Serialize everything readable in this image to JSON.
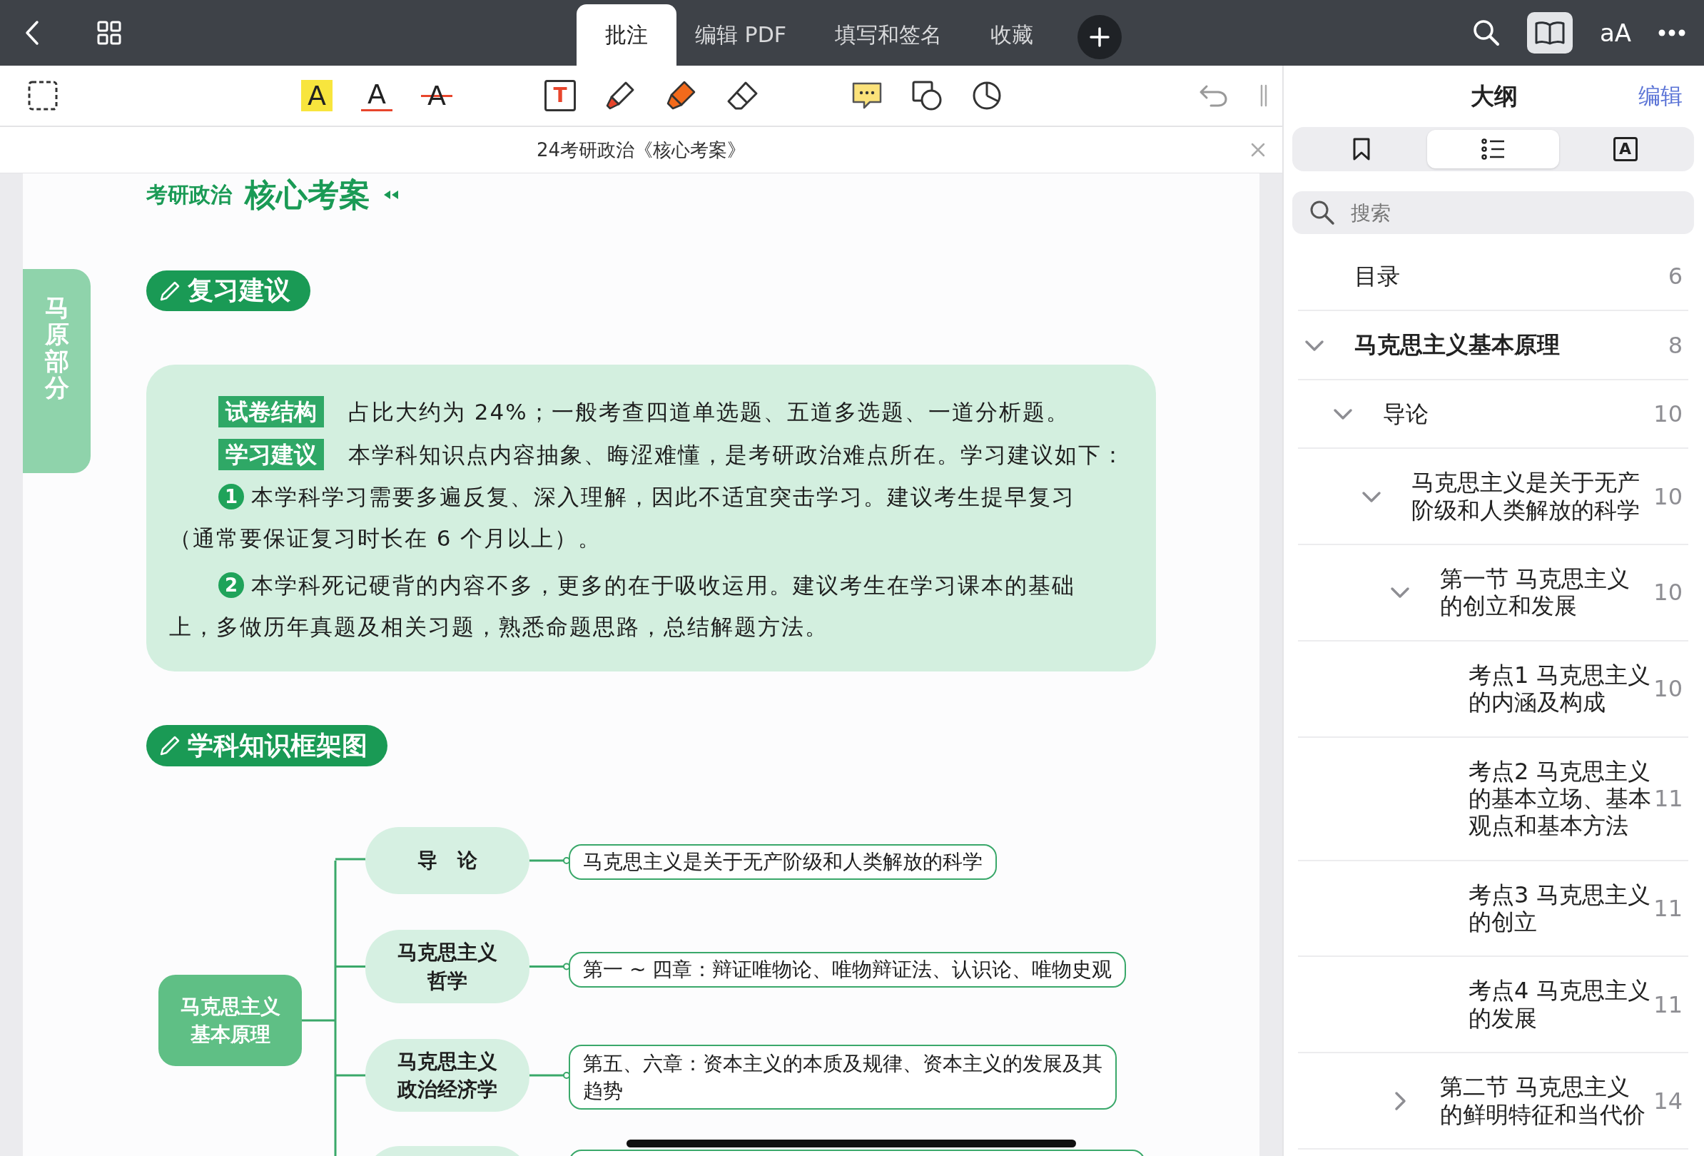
{
  "top_bar": {
    "tabs": [
      {
        "label": "批注",
        "selected": true
      },
      {
        "label": "编辑 PDF",
        "selected": false
      },
      {
        "label": "填写和签名",
        "selected": false
      },
      {
        "label": "收藏",
        "selected": false
      }
    ],
    "reader_view": {
      "selected": true
    },
    "font_button": "aA"
  },
  "toolbar": {
    "tools": [
      {
        "kind": "select"
      },
      {
        "kind": "highlight",
        "glyph": "A"
      },
      {
        "kind": "underline",
        "glyph": "A"
      },
      {
        "kind": "strikethrough",
        "glyph": "A"
      },
      {
        "kind": "textbox",
        "glyph": "T"
      },
      {
        "kind": "pen"
      },
      {
        "kind": "marker"
      },
      {
        "kind": "eraser"
      },
      {
        "kind": "comment"
      },
      {
        "kind": "shapes"
      },
      {
        "kind": "lasso"
      }
    ]
  },
  "document": {
    "title": "24考研政治《核心考案》",
    "header": {
      "small": "考研政治",
      "large": "核心考案"
    },
    "side_tab": "马原部分",
    "review": {
      "heading": "复习建议",
      "items": [
        {
          "kind": "labeled",
          "label": "试卷结构",
          "lines": [
            "占比大约为 24%；一般考查四道单选题、五道多选题、一道分析题。"
          ]
        },
        {
          "kind": "labeled",
          "label": "学习建议",
          "lines": [
            "本学科知识点内容抽象、晦涩难懂，是考研政治难点所在。学习建议如下："
          ]
        },
        {
          "kind": "numbered",
          "number": "1",
          "lines": [
            "本学科学习需要多遍反复、深入理解，因此不适宜突击学习。建议考生提早复习",
            "（通常要保证复习时长在 6 个月以上）。"
          ]
        },
        {
          "kind": "numbered",
          "number": "2",
          "lines": [
            "本学科死记硬背的内容不多，更多的在于吸收运用。建议考生在学习课本的基础",
            "上，多做历年真题及相关习题，熟悉命题思路，总结解题方法。"
          ]
        }
      ]
    },
    "framework": {
      "heading": "学科知识框架图",
      "root": [
        "马克思主义",
        "基本原理"
      ],
      "branches": [
        {
          "kind": "full",
          "node": [
            "导　论"
          ],
          "leaf": [
            "马克思主义是关于无产阶级和人类解放的科学"
          ]
        },
        {
          "kind": "full",
          "node": [
            "马克思主义",
            "哲学"
          ],
          "leaf": [
            "第一 ~ 四章：辩证唯物论、唯物辩证法、认识论、唯物史观"
          ]
        },
        {
          "kind": "full",
          "node": [
            "马克思主义",
            "政治经济学"
          ],
          "leaf": [
            "第五、六章：资本主义的本质及规律、资本主义的发展及其",
            "趋势"
          ]
        },
        {
          "kind": "cut"
        }
      ]
    }
  },
  "sidebar": {
    "title": "大纲",
    "edit": "编辑",
    "segments": [
      {
        "kind": "bookmarks",
        "selected": false
      },
      {
        "kind": "outline",
        "selected": true
      },
      {
        "kind": "annotations",
        "glyph": "A",
        "selected": false
      }
    ],
    "search": {
      "placeholder": "搜索"
    },
    "outline": [
      {
        "lines": [
          "目录"
        ],
        "page": "6"
      },
      {
        "lines": [
          "马克思主义基本原理"
        ],
        "page": "8",
        "expanded": true,
        "children": [
          {
            "lines": [
              "导论"
            ],
            "page": "10",
            "expanded": true,
            "children": [
              {
                "lines": [
                  "马克思主义是关于无产",
                  "阶级和人类解放的科学"
                ],
                "page": "10",
                "expanded": true,
                "children": [
                  {
                    "lines": [
                      "第一节 马克思主义",
                      "的创立和发展"
                    ],
                    "page": "10",
                    "expanded": true,
                    "children": [
                      {
                        "lines": [
                          "考点1 马克思主义",
                          "的内涵及构成"
                        ],
                        "page": "10"
                      },
                      {
                        "lines": [
                          "考点2 马克思主义",
                          "的基本立场、基本",
                          "观点和基本方法"
                        ],
                        "page": "11"
                      },
                      {
                        "lines": [
                          "考点3 马克思主义",
                          "的创立"
                        ],
                        "page": "11"
                      },
                      {
                        "lines": [
                          "考点4 马克思主义",
                          "的发展"
                        ],
                        "page": "11"
                      }
                    ]
                  },
                  {
                    "lines": [
                      "第二节 马克思主义",
                      "的鲜明特征和当代价"
                    ],
                    "page": "14",
                    "expanded": false
                  }
                ]
              }
            ]
          }
        ]
      }
    ]
  }
}
